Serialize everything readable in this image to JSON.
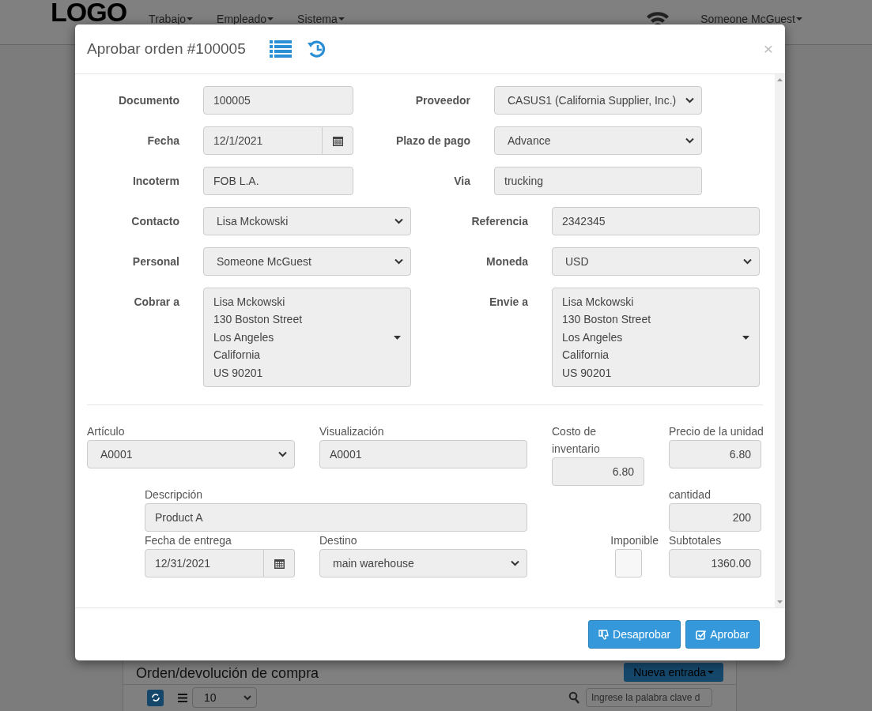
{
  "navbar": {
    "logo": "LOGO",
    "menus": [
      {
        "label": "Trabajo"
      },
      {
        "label": "Empleado"
      },
      {
        "label": "Sistema"
      }
    ],
    "user": "Someone McGuest"
  },
  "page": {
    "title": "Orden/devolución de compra",
    "new_button": "Nueva entrada",
    "page_size": "10",
    "search": {
      "placeholder": "Ingrese la palabra clave d"
    }
  },
  "dialog": {
    "title": "Aprobar orden #100005",
    "close": "×",
    "fields": [
      {
        "label": "Documento",
        "kind": "text",
        "value": "100005"
      },
      {
        "label": "Proveedor",
        "kind": "select",
        "value": "CASUS1 (California Supplier, Inc.)"
      },
      {
        "label": "Fecha",
        "kind": "date",
        "value": "12/1/2021"
      },
      {
        "label": "Plazo de pago",
        "kind": "select",
        "value": "Advance"
      },
      {
        "label": "Incoterm",
        "kind": "text",
        "value": "FOB L.A."
      },
      {
        "label": "Via",
        "kind": "text",
        "value": "trucking"
      },
      {
        "label": "Contacto",
        "kind": "select",
        "value": "Lisa Mckowski"
      },
      {
        "label": "Referencia",
        "kind": "text",
        "value": "2342345"
      },
      {
        "label": "Personal",
        "kind": "select",
        "value": "Someone McGuest"
      },
      {
        "label": "Moneda",
        "kind": "select",
        "value": "USD"
      },
      {
        "label": "Cobrar a",
        "kind": "address",
        "lines": [
          "Lisa Mckowski",
          "130 Boston Street",
          "Los Angeles",
          "California",
          "US 90201"
        ]
      },
      {
        "label": "Envie a",
        "kind": "address",
        "lines": [
          "Lisa Mckowski",
          "130 Boston Street",
          "Los Angeles",
          "California",
          "US 90201"
        ]
      }
    ],
    "items": [
      {
        "label": "Artículo",
        "kind": "select",
        "value": "A0001"
      },
      {
        "label": "Visualización",
        "kind": "text",
        "value": "A0001"
      },
      {
        "label": "Costo de inventario",
        "kind": "number",
        "value": "6.80"
      },
      {
        "label": "Precio de la unidad",
        "kind": "number",
        "value": "6.80"
      },
      {
        "label": "Descripción",
        "kind": "text",
        "value": "Product A"
      },
      {
        "label": "cantidad",
        "kind": "number",
        "value": "200"
      },
      {
        "label": "Fecha de entrega",
        "kind": "date",
        "value": "12/31/2021"
      },
      {
        "label": "Destino",
        "kind": "select",
        "value": "main warehouse"
      },
      {
        "label": "Imponible",
        "kind": "checkbox",
        "checked": false
      },
      {
        "label": "Subtotales",
        "kind": "number",
        "value": "1360.00"
      }
    ],
    "buttons": [
      {
        "label": "Desaprobar",
        "kind": "disapprove"
      },
      {
        "label": "Aprobar",
        "kind": "approve"
      }
    ]
  }
}
